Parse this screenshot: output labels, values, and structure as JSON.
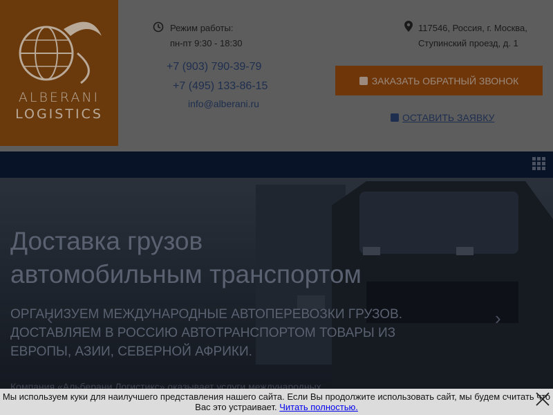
{
  "logo": {
    "line1": "ALBERANI",
    "line2": "LOGISTICS"
  },
  "contacts": {
    "hours_label": "Режим работы:",
    "hours_value": "пн-пт 9:30 - 18:30",
    "phone1": "+7 (903) 790-39-79",
    "phone2": "+7 (495) 133-86-15",
    "email": "info@alberani.ru",
    "address_line1": "117546, Россия, г. Москва,",
    "address_line2": "Ступинский проезд, д. 1"
  },
  "actions": {
    "callback_label": "ЗАКАЗАТЬ ОБРАТНЫЙ ЗВОНОК",
    "request_label": "ОСТАВИТЬ ЗАЯВКУ"
  },
  "hero": {
    "title_line1": "Доставка грузов",
    "title_line2": "автомобильным транспортом",
    "subtitle": "Организуем международные автоперевозки грузов. Доставляем в Россию автотранспортом товары из Европы, Азии, Северной Африки.",
    "body": "Компания «Альберани Логистикс» оказывает услуги международных"
  },
  "cookie": {
    "text": "Мы используем куки для наилучшего представления нашего сайта. Если Вы продолжите использовать сайт, мы будем считать что Вас это устраивает.",
    "link_label": "Читать полностью."
  },
  "colors": {
    "brand_orange": "#e8730c",
    "navy": "#1e2e4f"
  }
}
